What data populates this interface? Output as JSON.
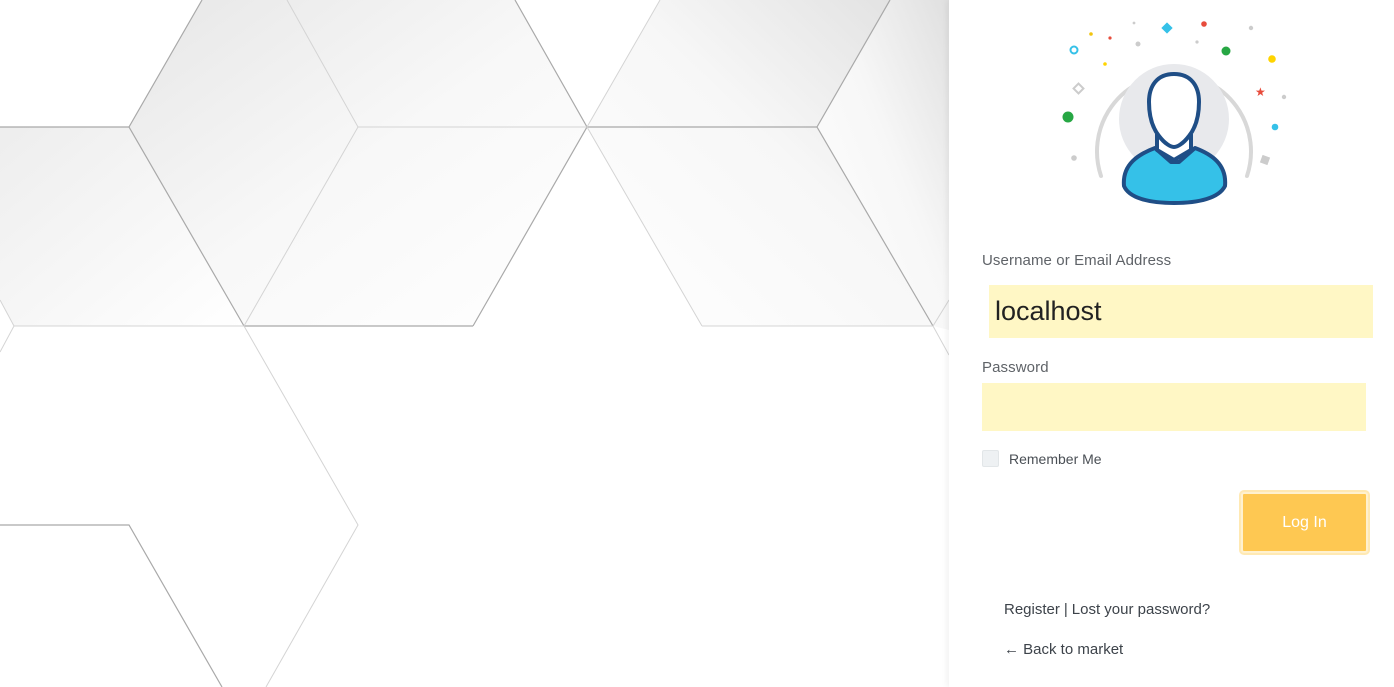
{
  "login": {
    "username_label": "Username or Email Address",
    "username_value": "localhost",
    "password_label": "Password",
    "password_value": "",
    "remember_label": "Remember Me",
    "login_button": "Log In"
  },
  "links": {
    "register": "Register",
    "separator": "|",
    "lost_password": "Lost your password?",
    "back_to_market": "← Back to market"
  },
  "colors": {
    "field_bg": "#fff7c5",
    "button_bg": "#fec852",
    "avatar_body": "#35c1e8",
    "avatar_outline": "#1f4e86"
  }
}
